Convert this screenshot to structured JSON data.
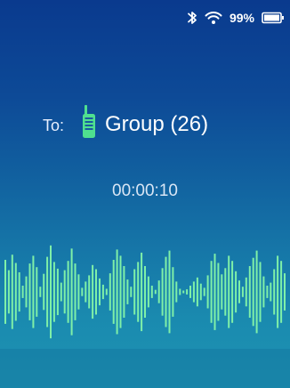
{
  "status_bar": {
    "battery_percent": "99%",
    "icons": [
      "bluetooth-icon",
      "wifi-icon",
      "battery-icon"
    ]
  },
  "call": {
    "to_label": "To:",
    "target_icon": "radio-icon",
    "group_name": "Group (26)",
    "elapsed": "00:00:10"
  },
  "colors": {
    "waveform": "#7ff0a8",
    "radio_icon": "#4fe08f",
    "text": "#ffffff"
  },
  "waveform": {
    "amplitudes": [
      0.62,
      0.42,
      0.72,
      0.56,
      0.38,
      0.12,
      0.3,
      0.55,
      0.7,
      0.48,
      0.1,
      0.35,
      0.68,
      0.9,
      0.58,
      0.45,
      0.18,
      0.42,
      0.6,
      0.84,
      0.55,
      0.34,
      0.08,
      0.2,
      0.32,
      0.52,
      0.44,
      0.26,
      0.14,
      0.06,
      0.36,
      0.62,
      0.82,
      0.7,
      0.5,
      0.24,
      0.1,
      0.44,
      0.58,
      0.76,
      0.5,
      0.3,
      0.12,
      0.04,
      0.22,
      0.46,
      0.68,
      0.8,
      0.48,
      0.2,
      0.06,
      0.02,
      0.05,
      0.12,
      0.2,
      0.28,
      0.16,
      0.08,
      0.32,
      0.6,
      0.74,
      0.56,
      0.34,
      0.46,
      0.7,
      0.6,
      0.4,
      0.22,
      0.1,
      0.28,
      0.5,
      0.66,
      0.8,
      0.58,
      0.3,
      0.12,
      0.18,
      0.44,
      0.7,
      0.6,
      0.36
    ]
  }
}
